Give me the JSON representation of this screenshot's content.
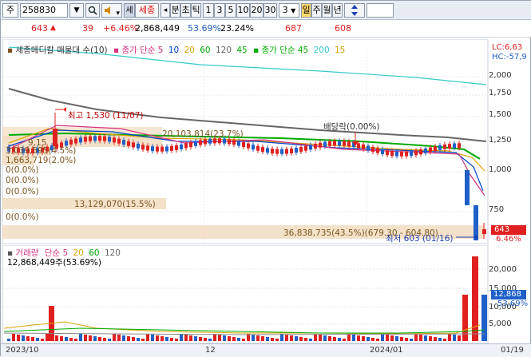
{
  "toolbar": {
    "market": "주",
    "code": "258830",
    "search_icon": "magnifier-icon",
    "sound_icon": "speaker-icon",
    "sound_arrow": "▾",
    "name_tab": "세종",
    "name_label": "세종",
    "prev_arrow": "◂",
    "minute_label": "분",
    "tick_label": "초",
    "period_label": "틱",
    "intervals": [
      "1",
      "3",
      "5",
      "10",
      "20",
      "30"
    ],
    "interval_value": "3",
    "day_label": "일",
    "week_label": "주",
    "month_label": "월",
    "year_label": "년",
    "updown_icon": "up-down-arrow-icon"
  },
  "info": {
    "price": "643",
    "change_arrow": "▲",
    "change": "39",
    "change_pct": "+6.46%",
    "volume": "2,868,449",
    "vol_ratio": "53.69%",
    "turnover": "23.24%",
    "high": "687",
    "low": "608"
  },
  "price_panel": {
    "legend_title": "세종메디칼 매물대 수(10)",
    "ma_label": "종가 단순",
    "ma_periods": [
      "5",
      "10",
      "20",
      "60",
      "120"
    ],
    "ma_colors": [
      "#d63384",
      "#0044cc",
      "#d9a400",
      "#00aa00",
      "#666666"
    ],
    "ma2_label": "종가 단순",
    "ma2_periods": [
      "45",
      "200",
      "15"
    ],
    "ma2_colors": [
      "#00aa00",
      "#33cccc",
      "#e0a000"
    ],
    "ma_extra": "45",
    "right_top1": "LC:6,63",
    "right_top2": "HC:-57,9",
    "yticks": [
      "2,000",
      "1,750",
      "1,500",
      "1,250",
      "1,000",
      "750"
    ],
    "high_annot": "최고 1,530 (11/07)",
    "low_annot": "최저 603 (01/16)",
    "dividend_annot": "배당락(0.00%)",
    "vp_labels": [
      "9,15",
      "3,039,595(4.5%)",
      "1,663,719(2.0%)",
      "0(0.0%)",
      "0(0.0%)",
      "0(0.0%)",
      "13,129,070(15.5%)",
      "0(0.0%)",
      "36,838,735(43.5%)(679.30 - 604.80)"
    ],
    "vp_mid_label": "20,103,814(23.7%)",
    "current_price_tag": "643",
    "current_pct_tag": "6.46%"
  },
  "volume_panel": {
    "legend_title": "거래량",
    "ma_label": "단순",
    "ma_periods": [
      "5",
      "20",
      "60",
      "120"
    ],
    "ma_colors": [
      "#d63384",
      "#d9a400",
      "#00aa00",
      "#666666"
    ],
    "current_value": "12,868,449주(53.69%)",
    "yticks": [
      "20,000",
      "15,000",
      "10,000",
      "5,000"
    ],
    "right_tag": "12,868",
    "right_tag2": "53,69%"
  },
  "xaxis": {
    "labels": [
      "2023/10",
      "12",
      "2024/01",
      "01/19"
    ]
  },
  "colors": {
    "up": "#e02020",
    "down": "#1f5fc8",
    "volume_profile": "#f2dcc0"
  }
}
